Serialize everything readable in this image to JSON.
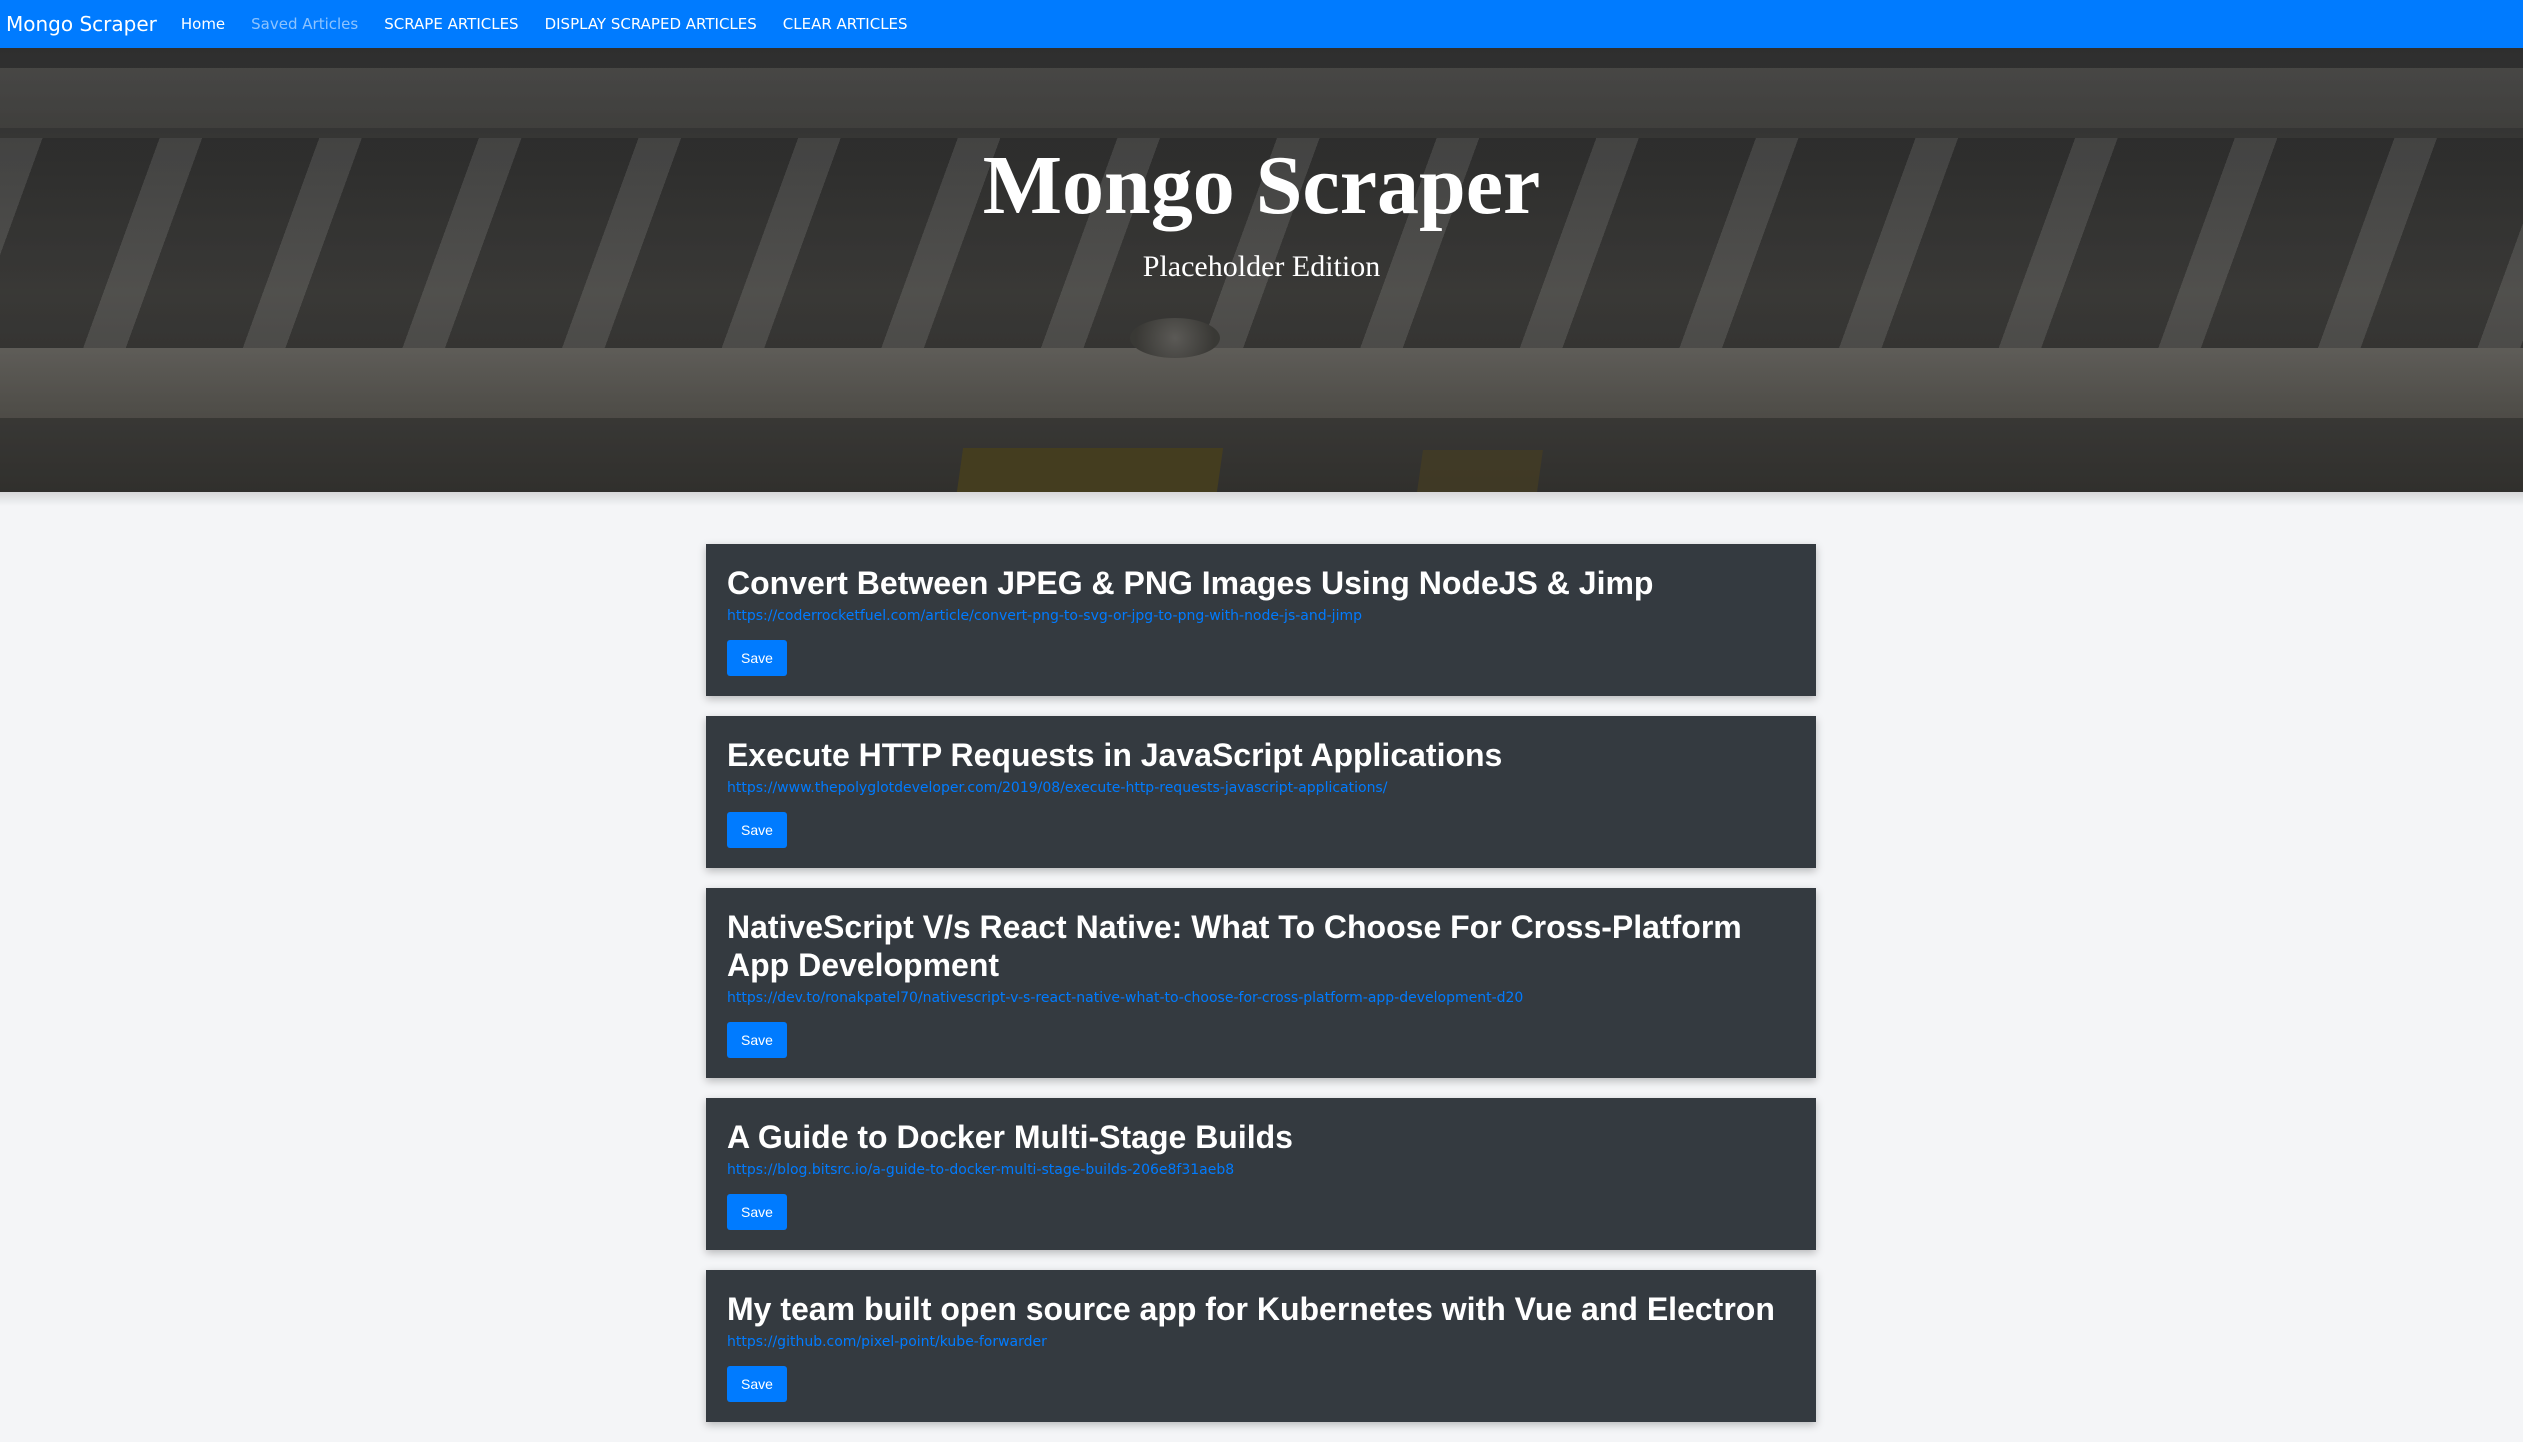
{
  "nav": {
    "brand": "Mongo Scraper",
    "links": [
      {
        "label": "Home",
        "muted": false
      },
      {
        "label": "Saved Articles",
        "muted": true
      },
      {
        "label": "SCRAPE ARTICLES",
        "muted": false
      },
      {
        "label": "DISPLAY SCRAPED ARTICLES",
        "muted": false
      },
      {
        "label": "CLEAR ARTICLES",
        "muted": false
      }
    ]
  },
  "hero": {
    "title": "Mongo Scraper",
    "subtitle": "Placeholder Edition"
  },
  "articles": [
    {
      "title": "Convert Between JPEG & PNG Images Using NodeJS & Jimp",
      "url": "https://coderrocketfuel.com/article/convert-png-to-svg-or-jpg-to-png-with-node-js-and-jimp",
      "button": "Save"
    },
    {
      "title": "Execute HTTP Requests in JavaScript Applications",
      "url": "https://www.thepolyglotdeveloper.com/2019/08/execute-http-requests-javascript-applications/",
      "button": "Save"
    },
    {
      "title": "NativeScript V/s React Native: What To Choose For Cross-Platform App Development",
      "url": "https://dev.to/ronakpatel70/nativescript-v-s-react-native-what-to-choose-for-cross-platform-app-development-d20",
      "button": "Save"
    },
    {
      "title": "A Guide to Docker Multi-Stage Builds",
      "url": "https://blog.bitsrc.io/a-guide-to-docker-multi-stage-builds-206e8f31aeb8",
      "button": "Save"
    },
    {
      "title": "My team built open source app for Kubernetes with Vue and Electron",
      "url": "https://github.com/pixel-point/kube-forwarder",
      "button": "Save"
    }
  ],
  "colors": {
    "primary": "#007bff",
    "card_bg": "#343a40",
    "page_bg": "#f4f5f7"
  }
}
